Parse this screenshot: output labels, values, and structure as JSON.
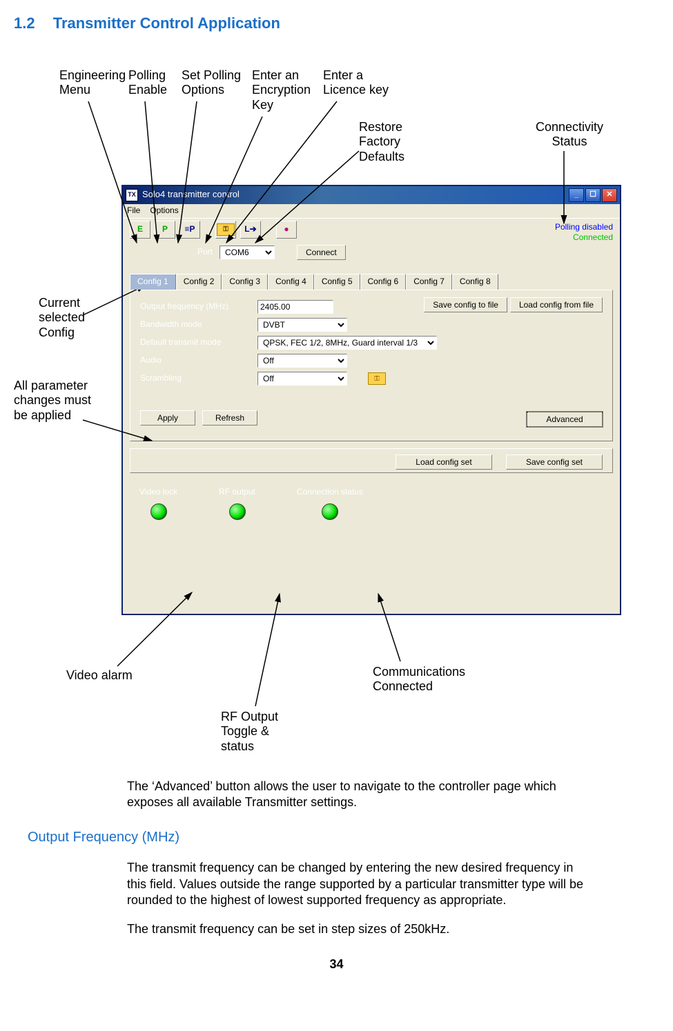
{
  "section": {
    "number": "1.2",
    "title": "Transmitter Control Application"
  },
  "annotations": {
    "engineering_menu": "Engineering\nMenu",
    "polling_enable": "Polling\nEnable",
    "set_polling": "Set Polling\nOptions",
    "encryption_key": "Enter an\nEncryption\nKey",
    "licence_key": "Enter a\nLicence key",
    "restore_defaults": "Restore\nFactory\nDefaults",
    "connectivity_status": "Connectivity\nStatus",
    "current_config": "Current\nselected\nConfig",
    "all_params": "All parameter\nchanges must\nbe applied",
    "video_alarm": "Video alarm",
    "rf_output": "RF Output\nToggle &\nstatus",
    "comms_connected": "Communications\nConnected"
  },
  "window": {
    "title": "Solo4 transmitter control",
    "menus": {
      "file": "File",
      "options": "Options"
    },
    "toolbar": {
      "eng": "E",
      "poll": "P",
      "pollopt": "≡P",
      "key": "🔑",
      "lic": "L➔",
      "restore": "●"
    },
    "status": {
      "polling": "Polling disabled",
      "connected": "Connected"
    },
    "port_label": "Port",
    "port_value": "COM6",
    "connect_label": "Connect",
    "tabs": [
      "Config 1",
      "Config 2",
      "Config 3",
      "Config 4",
      "Config 5",
      "Config 6",
      "Config 7",
      "Config 8"
    ],
    "fields": {
      "output_freq_label": "Output frequency (MHz)",
      "output_freq_value": "2405.00",
      "bandwidth_label": "Bandwidth mode",
      "bandwidth_value": "DVBT",
      "default_tx_label": "Default transmit mode",
      "default_tx_value": "QPSK, FEC 1/2, 8MHz, Guard interval 1/3",
      "audio_label": "Audio",
      "audio_value": "Off",
      "scrambling_label": "Scrambling",
      "scrambling_value": "Off"
    },
    "buttons": {
      "save_config_file": "Save config to file",
      "load_config_file": "Load config from file",
      "apply": "Apply",
      "refresh": "Refresh",
      "advanced": "Advanced",
      "load_config_set": "Load config set",
      "save_config_set": "Save config set"
    },
    "status_labels": {
      "video_lock": "Video lock",
      "rf_output": "RF output",
      "conn_status": "Connection status"
    }
  },
  "paragraphs": {
    "p1": "The ‘Advanced’ button allows the user to navigate to the controller page which exposes all available Transmitter settings.",
    "subheading": "Output Frequency (MHz)",
    "p2": "The transmit frequency can be changed by entering the new desired frequency in this field. Values outside the range supported by a particular transmitter type will be rounded to the highest of lowest supported frequency as appropriate.",
    "p3": "The transmit frequency can be set in step sizes of 250kHz."
  },
  "page_number": "34"
}
